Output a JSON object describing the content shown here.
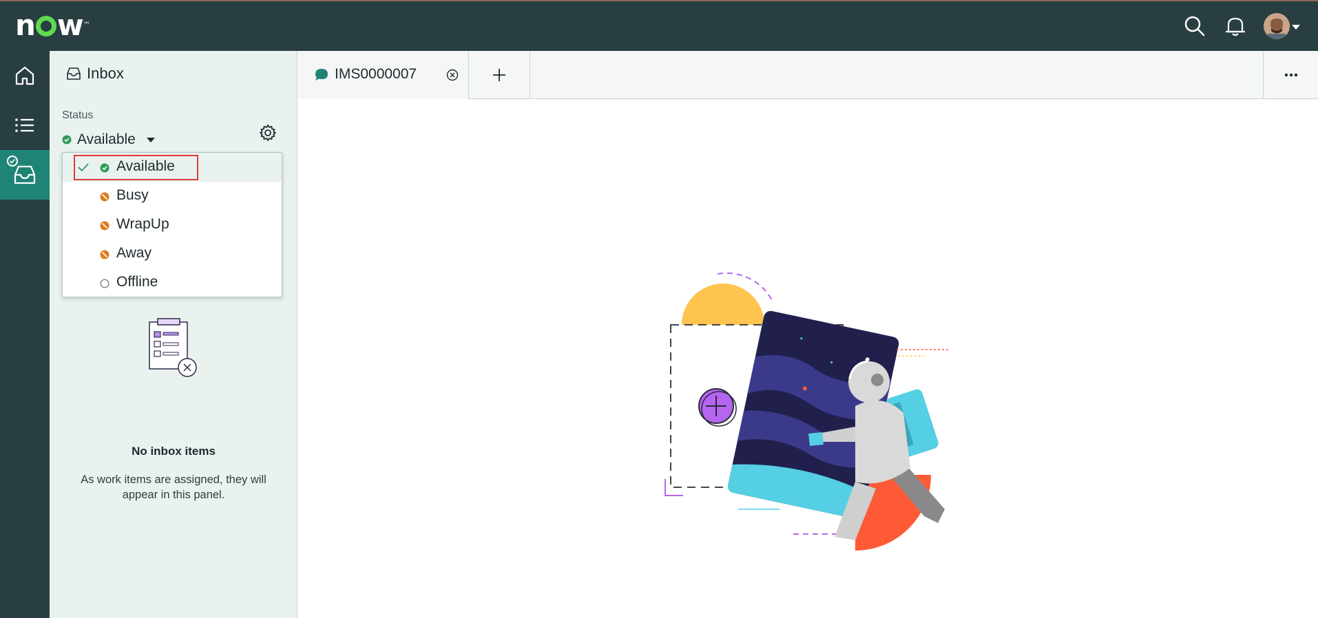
{
  "header": {
    "logo_text": "now",
    "logo_tm": "™"
  },
  "rail": {
    "items": [
      "home",
      "list",
      "inbox"
    ]
  },
  "panel": {
    "title": "Inbox",
    "status_label": "Status",
    "status_value": "Available",
    "status_options": [
      {
        "label": "Available",
        "state": "available",
        "selected": true
      },
      {
        "label": "Busy",
        "state": "busy",
        "selected": false
      },
      {
        "label": "WrapUp",
        "state": "busy",
        "selected": false
      },
      {
        "label": "Away",
        "state": "busy",
        "selected": false
      },
      {
        "label": "Offline",
        "state": "offline",
        "selected": false
      }
    ],
    "empty_title": "No inbox items",
    "empty_desc": "As work items are assigned, they will appear in this panel."
  },
  "tabs": {
    "items": [
      {
        "label": "IMS0000007"
      }
    ]
  },
  "colors": {
    "header_bg": "#293e41",
    "accent": "#1f8476",
    "panel_bg": "#e9f2ef",
    "available": "#2e9c58",
    "busy": "#e07b1f",
    "highlight": "#e03a3a"
  }
}
